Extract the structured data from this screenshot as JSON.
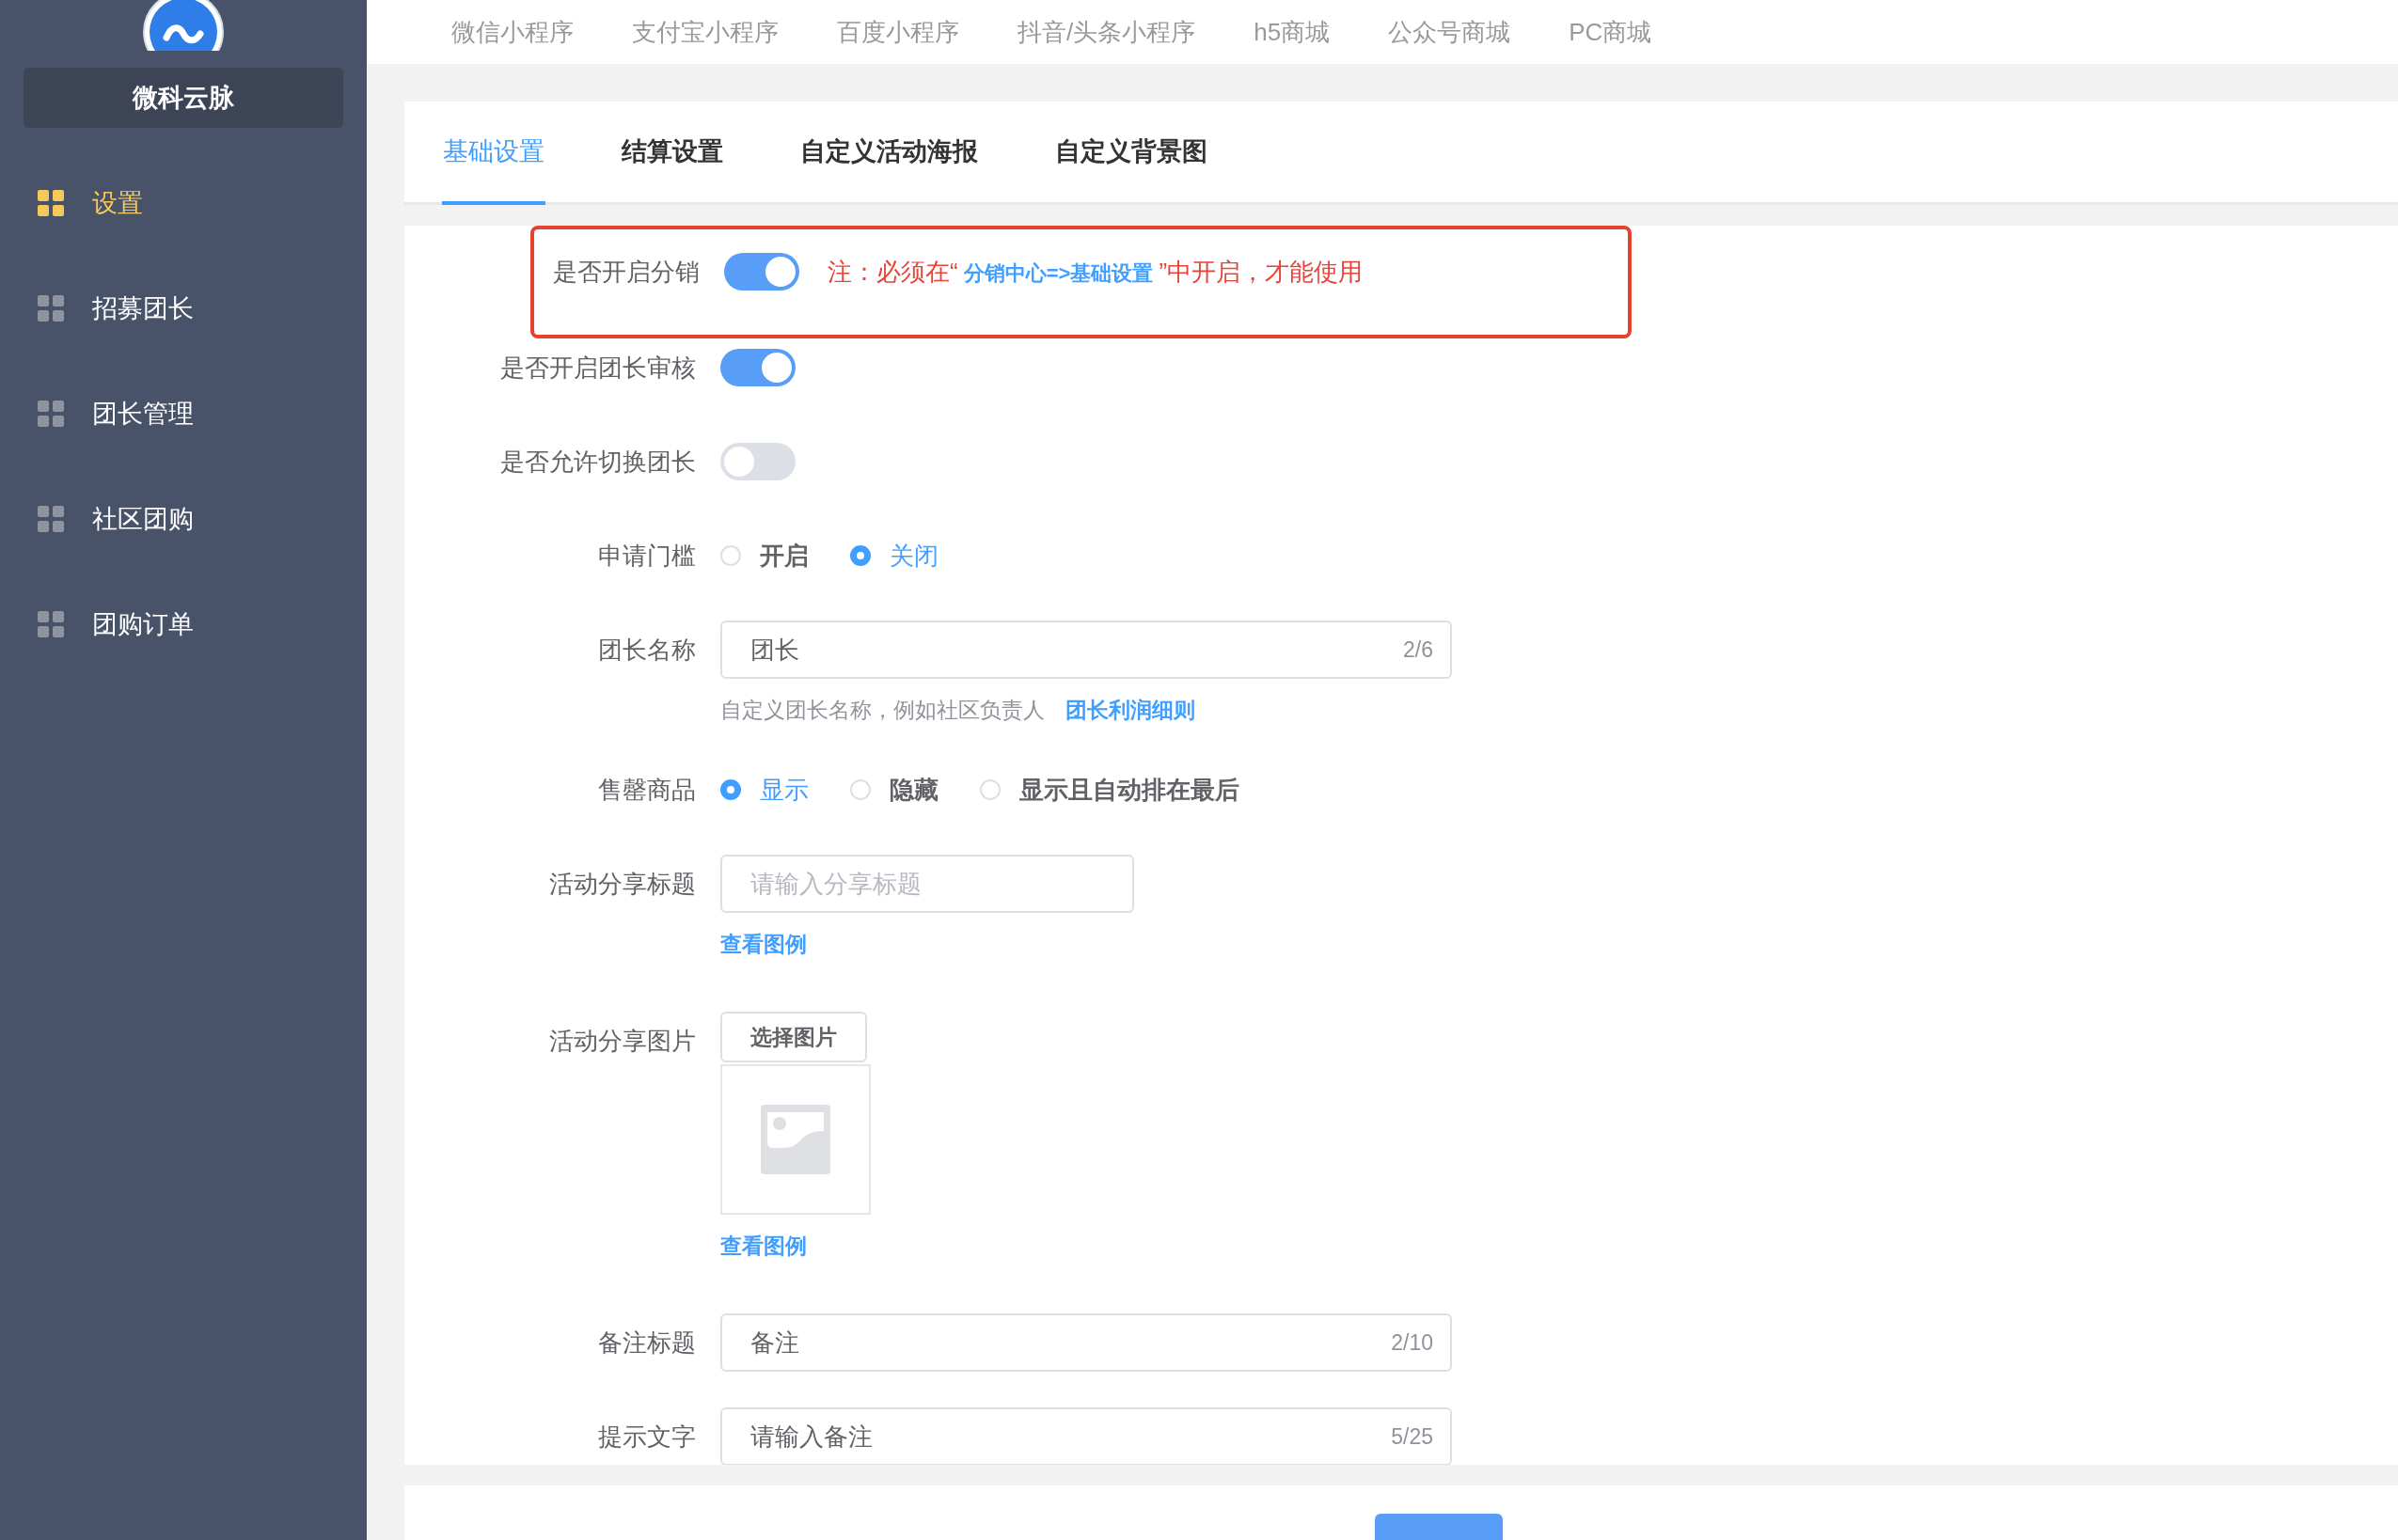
{
  "sidebar": {
    "brand": "微科云脉",
    "items": [
      {
        "label": "设置",
        "selected": true
      },
      {
        "label": "招募团长",
        "selected": false
      },
      {
        "label": "团长管理",
        "selected": false
      },
      {
        "label": "社区团购",
        "selected": false
      },
      {
        "label": "团购订单",
        "selected": false
      }
    ]
  },
  "top_nav": {
    "items": [
      "微信小程序",
      "支付宝小程序",
      "百度小程序",
      "抖音/头条小程序",
      "h5商城",
      "公众号商城",
      "PC商城"
    ]
  },
  "tabs": [
    {
      "label": "基础设置",
      "selected": true
    },
    {
      "label": "结算设置",
      "selected": false
    },
    {
      "label": "自定义活动海报",
      "selected": false
    },
    {
      "label": "自定义背景图",
      "selected": false
    }
  ],
  "form": {
    "fields": [
      {
        "kind": "switch",
        "label": "是否开启分销",
        "on": true,
        "highlighted": true,
        "note": {
          "prefix": "注：必须在“",
          "link": "分销中心=>基础设置",
          "suffix": "”中开启，才能使用"
        }
      },
      {
        "kind": "switch",
        "label": "是否开启团长审核",
        "on": true,
        "highlighted": false
      },
      {
        "kind": "switch",
        "label": "是否允许切换团长",
        "on": false,
        "highlighted": false
      },
      {
        "kind": "radio",
        "label": "申请门槛",
        "options": [
          {
            "label": "开启",
            "selected": false
          },
          {
            "label": "关闭",
            "selected": true
          }
        ]
      },
      {
        "kind": "input",
        "label": "团长名称",
        "value": "团长",
        "counter": "2/6",
        "hint": "自定义团长名称，例如社区负责人",
        "hint_link": "团长利润细则"
      },
      {
        "kind": "radio",
        "label": "售罄商品",
        "options": [
          {
            "label": "显示",
            "selected": true
          },
          {
            "label": "隐藏",
            "selected": false
          },
          {
            "label": "显示且自动排在最后",
            "selected": false
          }
        ]
      },
      {
        "kind": "input",
        "label": "活动分享标题",
        "placeholder": "请输入分享标题",
        "link": "查看图例"
      },
      {
        "kind": "image",
        "label": "活动分享图片",
        "button": "选择图片",
        "link": "查看图例"
      },
      {
        "kind": "input",
        "label": "备注标题",
        "value": "备注",
        "counter": "2/10"
      },
      {
        "kind": "input",
        "label": "提示文字",
        "value": "请输入备注",
        "counter": "5/25"
      }
    ]
  }
}
